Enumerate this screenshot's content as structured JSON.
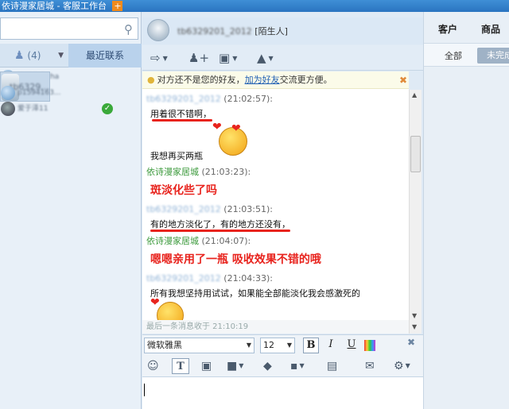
{
  "window": {
    "title": "依诗漫家居城 - 客服工作台"
  },
  "left": {
    "search_placeholder": "",
    "tab_contacts_count": "(4)",
    "tab_recent": "最近联系",
    "contacts": [
      {
        "name": "睛间空白cha"
      },
      {
        "name": "tb6329..."
      },
      {
        "name": "p1594163..."
      },
      {
        "name": "爱于泽11"
      }
    ]
  },
  "chat": {
    "header_name": "tb6329201_2012",
    "header_tag": "[陌生人]",
    "notice_pre": "对方还不是您的好友，",
    "notice_link": "加为好友",
    "notice_post": "交流更方便。",
    "messages": [
      {
        "sender": "tb6329201_2012",
        "time": "(21:02:57):",
        "text": "用着很不错啊，"
      },
      {
        "text": "我想再买两瓶"
      },
      {
        "sender": "依诗漫家居城",
        "time": "(21:03:23):",
        "text": "斑淡化些了吗"
      },
      {
        "sender": "tb6329201_2012",
        "time": "(21:03:51):",
        "text": "有的地方淡化了，有的地方还没有，"
      },
      {
        "sender": "依诗漫家居城",
        "time": "(21:04:07):",
        "text": "嗯嗯亲用了一瓶 吸收效果不错的哦"
      },
      {
        "sender": "tb6329201_2012",
        "time": "(21:04:33):",
        "text": "所有我想坚持用试试，如果能全部能淡化我会感激死的"
      }
    ],
    "last_received": "最后一条消息收于 21:10:19"
  },
  "format": {
    "font": "微软雅黑",
    "size": "12",
    "bold": "B",
    "italic": "I",
    "underline": "U"
  },
  "right": {
    "tab_customer": "客户",
    "tab_goods": "商品",
    "sub_all": "全部",
    "sub_unfinished": "未完成"
  },
  "colors": {
    "accent": "#2a74c0",
    "seller": "#3c9a3c",
    "highlight_text": "#e8231d"
  }
}
